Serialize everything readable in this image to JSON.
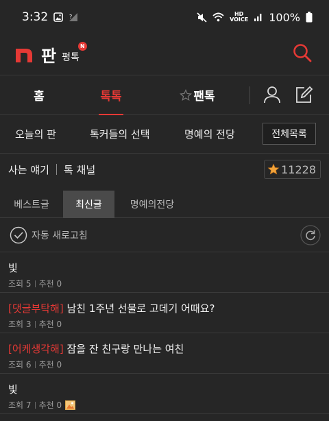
{
  "status_bar": {
    "time": "3:32",
    "hd_voice": "HD\nVOICE",
    "battery": "100%"
  },
  "app_bar": {
    "brand": "판",
    "section": "펑톡",
    "new_badge": "N"
  },
  "main_tabs": [
    {
      "label": "홈",
      "active": false
    },
    {
      "label": "톡톡",
      "active": true
    },
    {
      "label": "팬톡",
      "active": false
    }
  ],
  "sub_nav": {
    "items": [
      "오늘의 판",
      "톡커들의 선택",
      "명예의 전당"
    ],
    "all_button": "전체목록"
  },
  "channel": {
    "category": "사는 얘기",
    "name": "톡 채널",
    "favorite_count": "11228"
  },
  "list_tabs": [
    {
      "label": "베스트글",
      "active": false
    },
    {
      "label": "최신글",
      "active": true
    },
    {
      "label": "명예의전당",
      "active": false
    }
  ],
  "auto_refresh": {
    "label": "자동 새로고침"
  },
  "posts": [
    {
      "tag": "",
      "title": "빛",
      "views_label": "조회",
      "views": "5",
      "likes_label": "추천",
      "likes": "0",
      "has_image": false
    },
    {
      "tag": "[댓글부탁해]",
      "title": " 남친 1주년 선물로 고데기 어때요?",
      "views_label": "조회",
      "views": "3",
      "likes_label": "추천",
      "likes": "0",
      "has_image": false
    },
    {
      "tag": "[어케생각해]",
      "title": " 잠을 잔 친구랑 만나는 여친",
      "views_label": "조회",
      "views": "6",
      "likes_label": "추천",
      "likes": "0",
      "has_image": false
    },
    {
      "tag": "",
      "title": "빛",
      "views_label": "조회",
      "views": "7",
      "likes_label": "추천",
      "likes": "0",
      "has_image": true
    }
  ],
  "colors": {
    "background": "#262626",
    "accent": "#e53935",
    "divider": "#3a3a3a"
  }
}
